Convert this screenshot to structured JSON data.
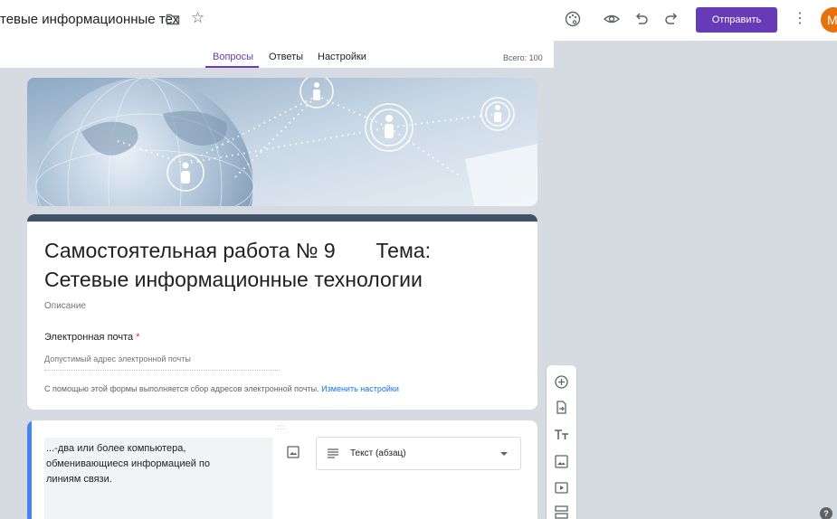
{
  "header": {
    "doc_title": "тевые информационные тех",
    "send_label": "Отправить",
    "avatar_letter": "М",
    "more_label": "⋮",
    "star_glyph": "☆",
    "icons": [
      "palette-icon",
      "preview-icon",
      "undo-icon",
      "redo-icon"
    ]
  },
  "tabs": {
    "items": [
      {
        "label": "Вопросы",
        "active": true
      },
      {
        "label": "Ответы",
        "active": false
      },
      {
        "label": "Настройки",
        "active": false
      }
    ],
    "total": "Всего: 100"
  },
  "form": {
    "title": "Самостоятельная работа № 9       Тема: Сетевые информационные технологии",
    "description": "Описание",
    "email_label": "Электронная почта",
    "required_mark": "*",
    "email_placeholder": "Допустимый адрес электронной почты",
    "collect_note": "С помощью этой формы выполняется сбор адресов электронной почты.",
    "collect_link": "Изменить настройки"
  },
  "question": {
    "drag_handle": ":::",
    "text": "...-два или более компьютера, обменивающиеся информацией по линиям связи.",
    "type_label": "Текст (абзац)"
  },
  "side_toolbar": [
    "add-question-icon",
    "import-questions-icon",
    "add-title-icon",
    "add-image-icon",
    "add-video-icon",
    "add-section-icon"
  ],
  "help_label": "?",
  "colors": {
    "accent": "#673ab7",
    "header_strip": "#3f5267",
    "question_bar": "#4285f4",
    "avatar": "#e8710a",
    "background": "#d6dbe2"
  }
}
